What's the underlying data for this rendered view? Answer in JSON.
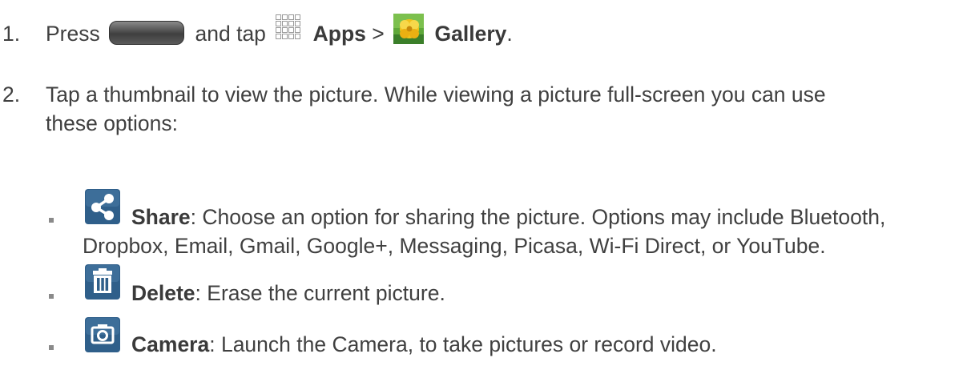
{
  "steps": [
    {
      "number": "1.",
      "t1": "Press",
      "t2": "and tap",
      "apps": "Apps",
      "sep": ">",
      "gallery": "Gallery",
      "end": "."
    },
    {
      "number": "2.",
      "line1": "Tap a thumbnail to view the picture. While viewing a picture full-screen you can use",
      "line2": "these options:"
    }
  ],
  "options": [
    {
      "icon": "share-icon",
      "title": "Share",
      "desc_line1": ": Choose an option for sharing the picture. Options may include Bluetooth,",
      "desc_line2": "Dropbox, Email, Gmail, Google+, Messaging, Picasa, Wi-Fi Direct, or YouTube."
    },
    {
      "icon": "delete-icon",
      "title": "Delete",
      "desc_line1": ": Erase the current picture."
    },
    {
      "icon": "camera-icon",
      "title": "Camera",
      "desc_line1": ": Launch the Camera, to take pictures or record video."
    }
  ],
  "colors": {
    "text": "#404040",
    "icon_bg": "#2f5f8a",
    "bullet": "#8a8a8a"
  }
}
